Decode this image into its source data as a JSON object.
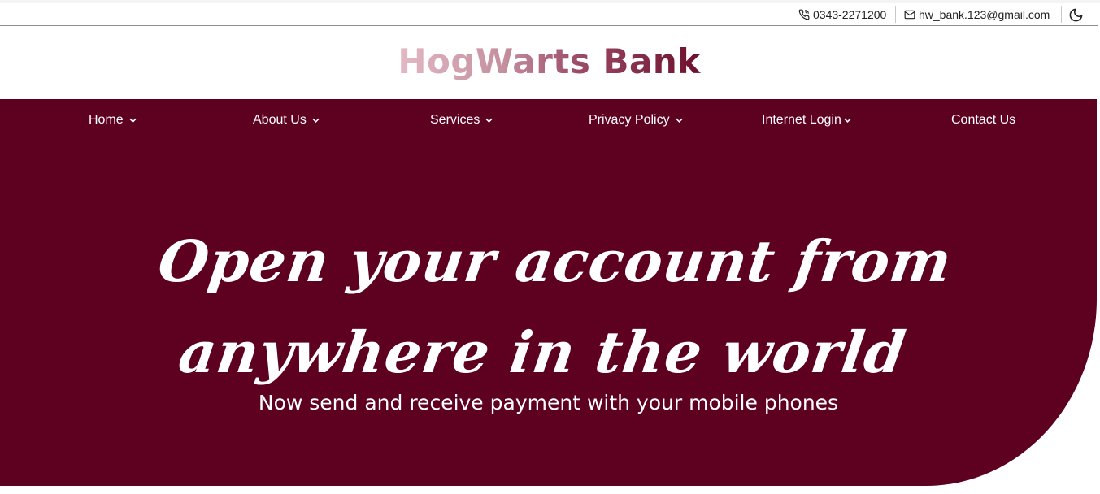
{
  "topbar": {
    "phone_icon": "phone-icon",
    "phone": "0343-2271200",
    "email_icon": "mail-icon",
    "email": "hw_bank.123@gmail.com",
    "theme_toggle_icon": "moon-icon"
  },
  "brand": {
    "title": "HogWarts Bank"
  },
  "nav": {
    "items": [
      {
        "label": "Home",
        "has_dropdown": true
      },
      {
        "label": "About Us",
        "has_dropdown": true
      },
      {
        "label": "Services",
        "has_dropdown": true
      },
      {
        "label": "Privacy Policy",
        "has_dropdown": true
      },
      {
        "label": "Internet Login",
        "has_dropdown": true
      },
      {
        "label": "Contact Us",
        "has_dropdown": false
      }
    ]
  },
  "hero": {
    "headline": "Open your account from anywhere in the world",
    "subheadline": "Now send and receive payment with your mobile phones"
  },
  "colors": {
    "brand_maroon": "#5e0020",
    "text_on_dark": "#ffffff",
    "brand_gradient_start": "#e3b9c6",
    "brand_gradient_end": "#6d0f2c"
  }
}
